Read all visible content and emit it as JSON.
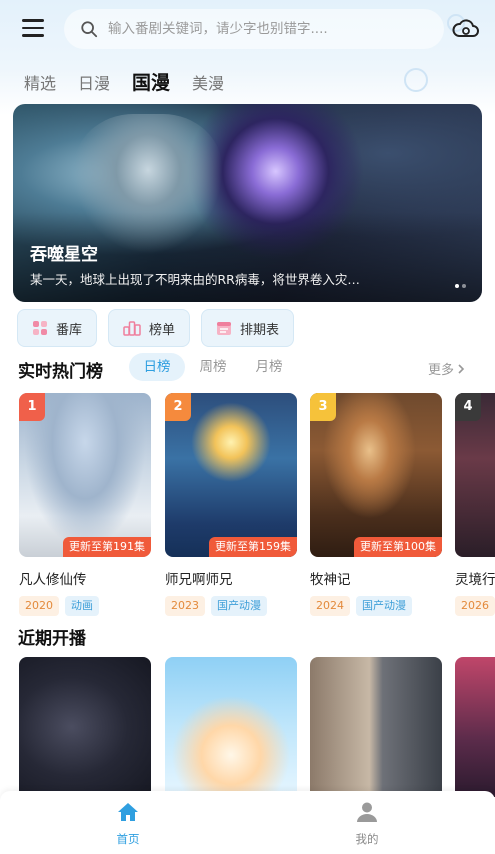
{
  "header": {
    "search_placeholder": "输入番剧关键词，请少字也别错字...."
  },
  "tabs": [
    {
      "label": "精选"
    },
    {
      "label": "日漫"
    },
    {
      "label": "国漫",
      "active": true
    },
    {
      "label": "美漫"
    }
  ],
  "banner": {
    "title": "吞噬星空",
    "description": "某一天，地球上出现了不明来由的RR病毒，将世界卷入灾…",
    "dots": 2,
    "active_dot": 0
  },
  "quick_buttons": [
    {
      "label": "番库",
      "icon": "library-icon"
    },
    {
      "label": "榜单",
      "icon": "ranking-icon"
    },
    {
      "label": "排期表",
      "icon": "calendar-icon"
    }
  ],
  "hot": {
    "title": "实时热门榜",
    "tabs": [
      {
        "label": "日榜",
        "active": true
      },
      {
        "label": "周榜"
      },
      {
        "label": "月榜"
      }
    ],
    "more_label": "更多",
    "items": [
      {
        "rank": "1",
        "title": "凡人修仙传",
        "update": "更新至第191集",
        "year": "2020",
        "genre": "动画"
      },
      {
        "rank": "2",
        "title": "师兄啊师兄",
        "update": "更新至第159集",
        "year": "2023",
        "genre": "国产动漫"
      },
      {
        "rank": "3",
        "title": "牧神记",
        "update": "更新至第100集",
        "year": "2024",
        "genre": "国产动漫"
      },
      {
        "rank": "4",
        "title": "灵境行者",
        "update": "",
        "year": "2026",
        "genre": ""
      }
    ],
    "rank_colors": [
      "#f0604a",
      "#f58a3d",
      "#f6c23a",
      "#3a3a3a"
    ]
  },
  "recent": {
    "title": "近期开播"
  },
  "bottom_nav": [
    {
      "label": "首页",
      "icon": "home-icon",
      "active": true
    },
    {
      "label": "我的",
      "icon": "user-icon",
      "active": false
    }
  ],
  "colors": {
    "accent": "#2f9fe0",
    "update_badge": "#f05a3a"
  }
}
